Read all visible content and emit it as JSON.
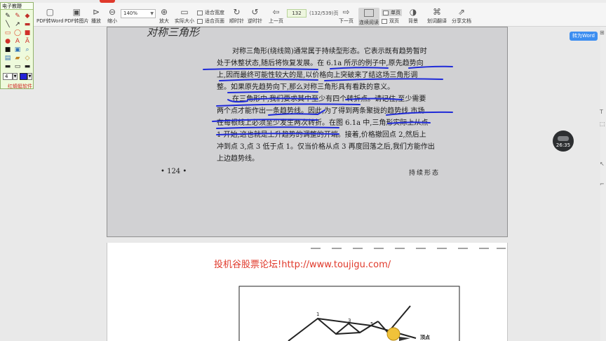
{
  "toolbar": {
    "tab_label": "",
    "to_word": "PDF转Word",
    "to_image": "PDF转图片",
    "play": "播放",
    "zoom_out": "缩小",
    "zoom_value": "140%",
    "zoom_in": "放大",
    "actual_size": "实际大小",
    "fit_width": "适合宽度",
    "fit_page": "适合页面",
    "rotate_cw": "顺时针",
    "rotate_ccw": "逆时针",
    "prev_page": "上一页",
    "current_page": "132",
    "page_count": "(132/539)页",
    "next_page": "下一页",
    "continuous": "连续阅读",
    "single_page": "单页",
    "double_page": "双页",
    "background": "背景",
    "translate": "划词翻译",
    "share": "分享文档"
  },
  "tool_panel": {
    "title": "电子教鞭",
    "pen_size": "4",
    "pen_color": "#2323d6",
    "brand": "红蜻蜓软件"
  },
  "page1": {
    "heading": "对称三角形",
    "lines": [
      "对称三角形(绕线简)通常属于持续型形态。它表示既有趋势暂时",
      "处于休整状态,随后将恢复发展。在 6.1a 所示的例子中,原先趋势向",
      "上,因而最终可能性较大的是,以价格向上突破来了结这场三角形调",
      "整。如果原先趋势向下,那么对称三角形具有看跌的意义。",
      "在三角形中,我们要求其中至少有四个转折点。请记住,至少需要",
      "两个点才能作出一条趋势线。因此,为了得到两条聚拢的趋势线,市场",
      "在每根线上必须至少发生两次转折。在图 6.1a 中,三角形实际上从点",
      "1 开始,这也就是上升趋势的调整的开端。接着,价格撤回点 2,然后上",
      "冲到点 3,点 3 低于点 1。仅当价格从点 3 再度回落之后,我们方能作出",
      "上边趋势线。"
    ],
    "page_number": "• 124 •",
    "running_head": "持续形态"
  },
  "page2": {
    "forum_text": "投机谷股票论坛!http://www.toujigu.com/",
    "chart_labels": [
      "1",
      "3",
      "5"
    ],
    "apex_label": "顶点"
  },
  "side": {
    "to_word": "转为Word",
    "timer": "26:35"
  }
}
